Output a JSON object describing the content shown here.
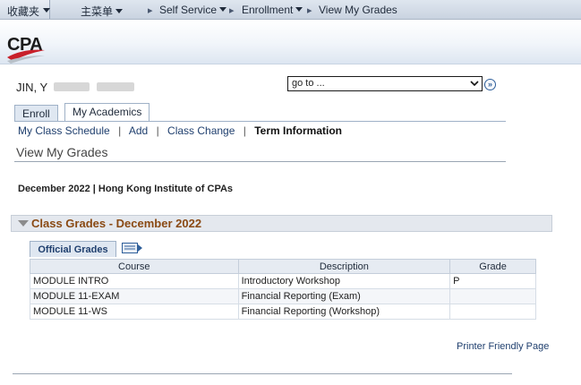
{
  "topnav": {
    "favorites": "收藏夹",
    "main_menu": "主菜单",
    "self_service": "Self Service",
    "enrollment": "Enrollment",
    "current": "View My Grades"
  },
  "header": {
    "logo": "CPA"
  },
  "student": {
    "name": "JIN, Y"
  },
  "goto": {
    "value": "go to ..."
  },
  "tabs": [
    {
      "label": "Enroll"
    },
    {
      "label": "My Academics"
    }
  ],
  "sublinks": [
    {
      "label": "My Class Schedule"
    },
    {
      "label": "Add"
    },
    {
      "label": "Class Change"
    },
    {
      "label": "Term Information"
    }
  ],
  "page_title": "View My Grades",
  "term": "December 2022 | Hong Kong Institute of CPAs",
  "section": {
    "title": "Class Grades - December 2022"
  },
  "grades_tab": {
    "label": "Official Grades"
  },
  "table": {
    "headers": [
      "Course",
      "Description",
      "Grade"
    ],
    "rows": [
      [
        "MODULE INTRO",
        "Introductory Workshop",
        "P"
      ],
      [
        "MODULE 11-EXAM",
        "Financial Reporting (Exam)",
        ""
      ],
      [
        "MODULE 11-WS",
        "Financial Reporting (Workshop)",
        ""
      ]
    ]
  },
  "printer_link": "Printer Friendly Page",
  "colors": {
    "accent_brown": "#8a4a14",
    "link_blue": "#1f3f6e",
    "logo_red": "#c8202a"
  }
}
